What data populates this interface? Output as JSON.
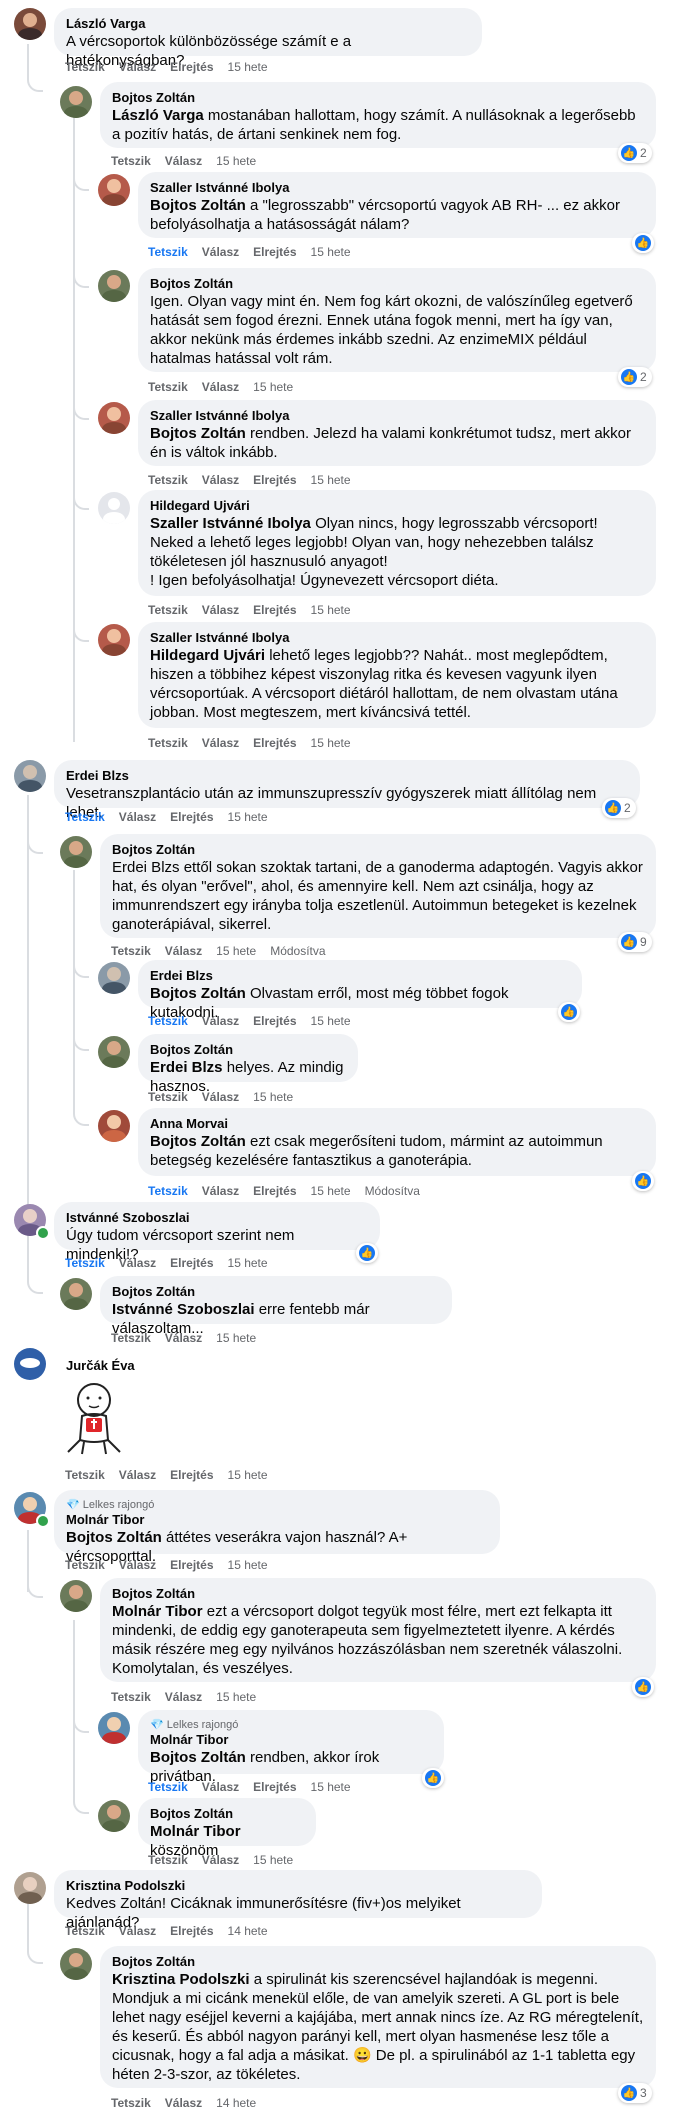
{
  "actions": {
    "like": "Tetszik",
    "reply": "Válasz",
    "hide": "Elrejtés",
    "edited": "Módosítva"
  },
  "comments": [
    {
      "name": "László Varga",
      "text": "A vércsoportok különbözössége számít e a hatékonyságban?",
      "time": "15 hete"
    },
    {
      "name": "Bojtos Zoltán",
      "mention": "László Varga",
      "text": " mostanában hallottam, hogy számít. A nullásoknak a legerősebb a pozitív hatás, de ártani senkinek nem fog.",
      "time": "15 hete",
      "reactions": "2"
    },
    {
      "name": "Szaller Istvánné Ibolya",
      "mention": "Bojtos Zoltán",
      "text": " a \"legrosszabb\" vércsoportú vagyok AB RH- ... ez akkor befolyásolhatja a hatásosságát nálam?",
      "time": "15 hete"
    },
    {
      "name": "Bojtos Zoltán",
      "text": "Igen. Olyan vagy mint én. Nem fog kárt okozni, de valószínűleg egetverő hatását sem fogod érezni. Ennek utána fogok menni, mert ha így van, akkor nekünk más érdemes inkább szedni. Az enzimeMIX például hatalmas hatással volt rám.",
      "time": "15 hete",
      "reactions": "2"
    },
    {
      "name": "Szaller Istvánné Ibolya",
      "mention": "Bojtos Zoltán",
      "text": " rendben. Jelezd ha valami konkrétumot tudsz, mert akkor én is váltok inkább.",
      "time": "15 hete"
    },
    {
      "name": "Hildegard Ujvári",
      "mention": "Szaller Istvánné Ibolya",
      "text": " Olyan nincs, hogy legrosszabb vércsoport! Neked a lehető leges legjobb! Olyan van, hogy nehezebben találsz tökéletesen jól hasznusuló anyagot!\n! Igen befolyásolhatja! Úgynevezett vércsoport diéta.",
      "time": "15 hete"
    },
    {
      "name": "Szaller Istvánné Ibolya",
      "mention": "Hildegard Ujvári",
      "text": " lehető leges legjobb?? Nahát.. most meglepődtem, hiszen a többihez képest viszonylag ritka és kevesen vagyunk ilyen vércsoportúak. A vércsoport diétáról hallottam, de nem olvastam utána jobban. Most megteszem, mert kíváncsivá tettél.",
      "time": "15 hete"
    },
    {
      "name": "Erdei Blzs",
      "text": "Vesetranszplantácio után az immunszupresszív gyógyszerek miatt állítólag nem lehet.",
      "time": "15 hete",
      "reactions": "2"
    },
    {
      "name": "Bojtos Zoltán",
      "text": "Erdei Blzs ettől sokan szoktak tartani, de a ganoderma adaptogén. Vagyis akkor hat, és olyan \"erővel\", ahol, és amennyire kell. Nem azt csinálja, hogy az immunrendszert egy irányba tolja eszetlenül. Autoimmun betegeket is kezelnek ganoterápiával, sikerrel.",
      "time": "15 hete",
      "reactions": "9"
    },
    {
      "name": "Erdei Blzs",
      "mention": "Bojtos Zoltán",
      "text": " Olvastam erről, most még többet fogok kutakodni.",
      "time": "15 hete"
    },
    {
      "name": "Bojtos Zoltán",
      "mention": "Erdei Blzs",
      "text": " helyes. Az mindig hasznos.",
      "time": "15 hete"
    },
    {
      "name": "Anna Morvai",
      "mention": "Bojtos Zoltán",
      "text": " ezt csak megerősíteni tudom, mármint az autoimmun betegség kezelésére fantasztikus a ganoterápia.",
      "time": "15 hete"
    },
    {
      "name": "Istvánné Szoboszlai",
      "text": "Úgy tudom vércsoport szerint nem mindenki!?",
      "time": "15 hete"
    },
    {
      "name": "Bojtos Zoltán",
      "mention": "Istvánné Szoboszlai",
      "text": " erre fentebb már válaszoltam...",
      "time": "15 hete"
    },
    {
      "name": "Jurčák Éva",
      "text": "",
      "time": "15 hete"
    },
    {
      "badge": "Lelkes rajongó",
      "name": "Molnár Tibor",
      "mention": "Bojtos Zoltán",
      "text": " áttétes veserákra vajon használ? A+ vércsoporttal.",
      "time": "15 hete"
    },
    {
      "name": "Bojtos Zoltán",
      "mention": "Molnár Tibor",
      "text": " ezt a vércsoport dolgot tegyük most félre, mert ezt felkapta itt mindenki, de eddig egy ganoterapeuta sem figyelmeztetett ilyenre. A kérdés másik részére meg egy nyilvános hozzászólásban nem szeretnék válaszolni. Komolytalan, és veszélyes.",
      "time": "15 hete"
    },
    {
      "badge": "Lelkes rajongó",
      "name": "Molnár Tibor",
      "mention": "Bojtos Zoltán",
      "text": " rendben, akkor írok privátban.",
      "time": "15 hete"
    },
    {
      "name": "Bojtos Zoltán",
      "mention": "Molnár Tibor",
      "text": " köszönöm",
      "time": "15 hete"
    },
    {
      "name": "Krisztina Podolszki",
      "text": "Kedves Zoltán! Cicáknak immunerősítésre (fiv+)os melyiket ajánlanád?",
      "time": "14 hete"
    },
    {
      "name": "Bojtos Zoltán",
      "mention": "Krisztina Podolszki",
      "text": " a spirulinát kis szerencsével hajlandóak is megenni. Mondjuk a mi cicánk menekül előle, de van amelyik szereti. A GL port is bele lehet nagy eséjjel keverni a kajájába, mert annak nincs íze. Az RG méregtelenít, és keserű. És abból nagyon parányi kell, mert olyan hasmenése lesz tőle a cicusnak, hogy a fal adja a másikat. 😀 De pl. a spirulinából az 1-1 tabletta egy héten 2-3-szor, az tökéletes.",
      "time": "14 hete",
      "reactions": "3"
    }
  ]
}
